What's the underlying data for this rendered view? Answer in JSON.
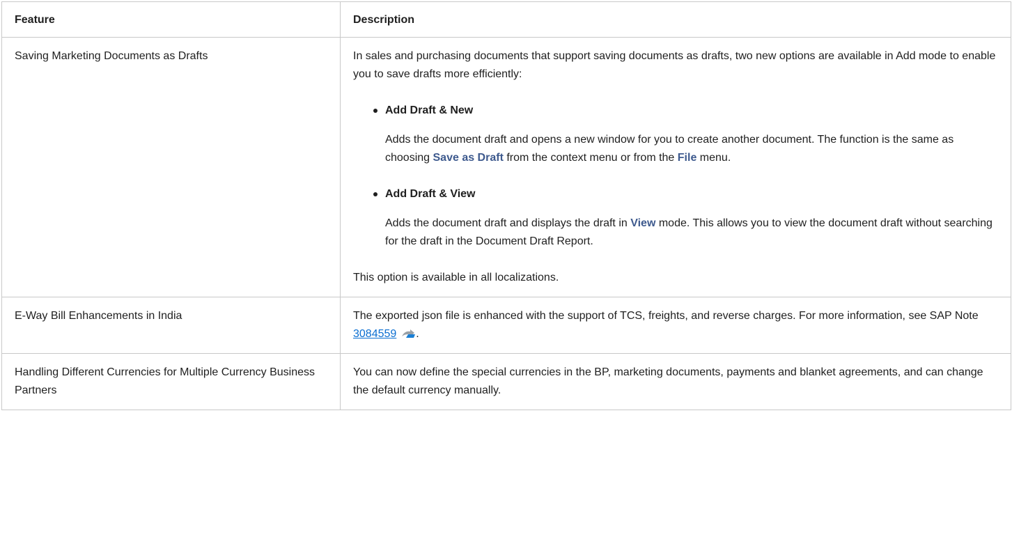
{
  "table": {
    "headers": {
      "feature": "Feature",
      "description": "Description"
    },
    "rows": [
      {
        "feature": "Saving Marketing Documents as Drafts",
        "intro": "In sales and purchasing documents that support saving documents as drafts, two new options are available in Add mode to enable you to save drafts more efficiently:",
        "options": [
          {
            "title": "Add Draft & New",
            "desc_before": "Adds the document draft and opens a new window for you to create another document. The function is the same as choosing ",
            "ui1": "Save as Draft",
            "desc_middle": " from the context menu or from the ",
            "ui2": "File",
            "desc_after": " menu."
          },
          {
            "title": "Add Draft & View",
            "desc_before": "Adds the document draft and displays the draft in ",
            "ui1": "View",
            "desc_after": " mode. This allows you to view the document draft without searching for the draft in the Document Draft Report."
          }
        ],
        "availability": "This option is available in all localizations."
      },
      {
        "feature": "E-Way Bill Enhancements in India",
        "text_before": "The exported json file is enhanced with the support of TCS, freights, and reverse charges. For more information, see SAP Note ",
        "link": "3084559",
        "text_after": "."
      },
      {
        "feature": "Handling Different Currencies for Multiple Currency Business Partners",
        "text": "You can now define the special currencies in the BP, marketing documents, payments and blanket agreements, and can change the default currency manually."
      }
    ]
  },
  "icons": {
    "external_link": "external-link-icon"
  },
  "colors": {
    "ui_term": "#3e5a8e",
    "link": "#0a6ed1",
    "border": "#c8c8c8"
  }
}
